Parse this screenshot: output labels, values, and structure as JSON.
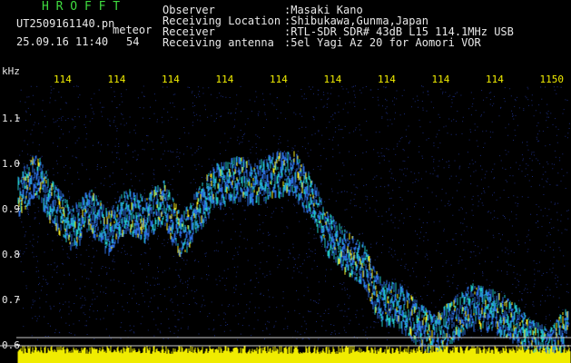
{
  "header": {
    "program_name": "H R O F F T",
    "filename": "UT2509161140.pn",
    "detection_label": "meteor",
    "datetime": "25.09.16 11:40",
    "count": "54",
    "fields": [
      {
        "label": "Observer",
        "value": ":Masaki Kano"
      },
      {
        "label": "Receiving Location",
        "value": ":Shibukawa,Gunma,Japan"
      },
      {
        "label": "Receiver",
        "value": ":RTL-SDR SDR# 43dB L15 114.1MHz USB"
      },
      {
        "label": "Receiving antenna",
        "value": ":5el Yagi Az 20 for Aomori VOR"
      }
    ]
  },
  "spectrogram": {
    "unit_label": "kHz",
    "y_ticks": [
      "1.1",
      "1.0",
      "0.9",
      "0.8",
      "0.7",
      "0.6"
    ],
    "time_labels": [
      "114",
      "114",
      "114",
      "114",
      "114",
      "114",
      "114",
      "114",
      "114",
      "1150"
    ],
    "colors": {
      "background": "#000000",
      "noise": "#1a2a7a",
      "signal_low": "#2a6ad8",
      "signal_mid": "#20c0c0",
      "signal_high": "#e8e020",
      "text": "#e8e8e8",
      "title": "#3fdc3f",
      "time_label": "#f0ec00",
      "noise_floor_bar": "#f0ec00",
      "gridline": "#c8c8c8"
    }
  }
}
